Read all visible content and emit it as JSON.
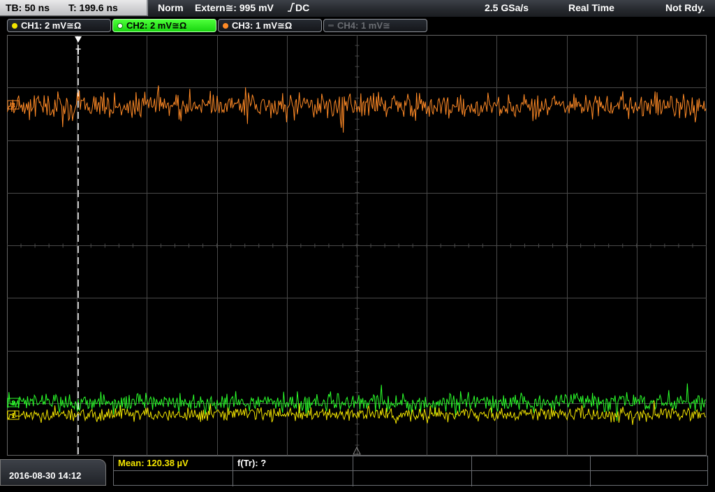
{
  "status_bar": {
    "timebase": "TB: 50 ns",
    "trigger_time": "T: 199.6 ns",
    "trigger_mode": "Norm",
    "trigger_source": "Extern≅: 995 mV",
    "trigger_coupling": "DC",
    "sample_rate": "2.5 GSa/s",
    "acq_mode": "Real Time",
    "run_state": "Not Rdy."
  },
  "channels": [
    {
      "label": "CH1: 2 mV≅Ω",
      "color": "#f2e400",
      "state": "on"
    },
    {
      "label": "CH2: 2 mV≅Ω",
      "color": "#2bff2b",
      "state": "active"
    },
    {
      "label": "CH3: 1 mV≅Ω",
      "color": "#ff8a26",
      "state": "on"
    },
    {
      "label": "CH4: 1 mV≅",
      "color": "#6b6e73",
      "state": "off"
    }
  ],
  "screen": {
    "trigger_marker": "T",
    "ch1_marker": "1",
    "ch2_marker": "2",
    "ch3_marker": "3"
  },
  "bottom_bar": {
    "datetime": "2016-08-30 14:12",
    "measurement_mean": "Mean: 120.38 µV",
    "measurement_rise": "f(Tr): ?"
  },
  "colors": {
    "ch1": "#f2e400",
    "ch2": "#2bff2b",
    "ch3": "#ff8a26",
    "grid": "#4a4a4a",
    "trigger_line": "#ffffff"
  }
}
